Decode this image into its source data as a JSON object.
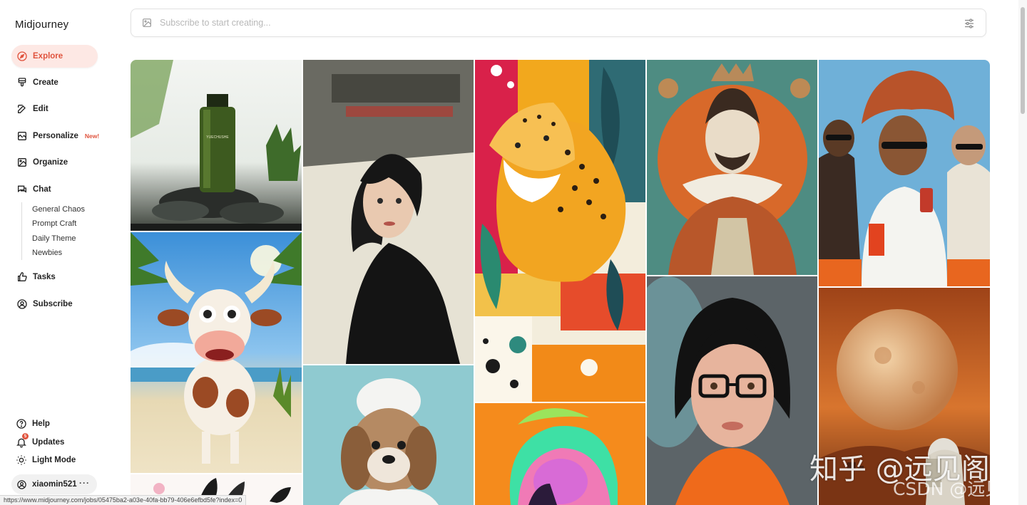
{
  "app": {
    "title": "Midjourney"
  },
  "nav": {
    "items": [
      {
        "label": "Explore",
        "icon": "compass-icon",
        "active": true
      },
      {
        "label": "Create",
        "icon": "brush-icon"
      },
      {
        "label": "Edit",
        "icon": "edit-icon"
      },
      {
        "label": "Personalize",
        "icon": "personalize-icon",
        "badge": "New!"
      },
      {
        "label": "Organize",
        "icon": "image-icon"
      },
      {
        "label": "Chat",
        "icon": "chat-icon"
      },
      {
        "label": "Tasks",
        "icon": "thumbs-up-icon"
      },
      {
        "label": "Subscribe",
        "icon": "user-circle-icon"
      }
    ],
    "chat_rooms": [
      "General Chaos",
      "Prompt Craft",
      "Daily Theme",
      "Newbies"
    ]
  },
  "footer": {
    "help": "Help",
    "updates": "Updates",
    "updates_count": "5",
    "theme": "Light Mode",
    "username": "xiaomin521",
    "more": "···"
  },
  "search": {
    "placeholder": "Subscribe to start creating..."
  },
  "colors": {
    "accent": "#e0533d",
    "active_bg": "#fde8e4"
  },
  "status_url": "https://www.midjourney.com/jobs/05475ba2-a03e-40fa-bb79-406e6efbd5fe?index=0",
  "watermark": {
    "line1": "知乎 @远见阁",
    "line2": "CSDN @远见阁"
  }
}
